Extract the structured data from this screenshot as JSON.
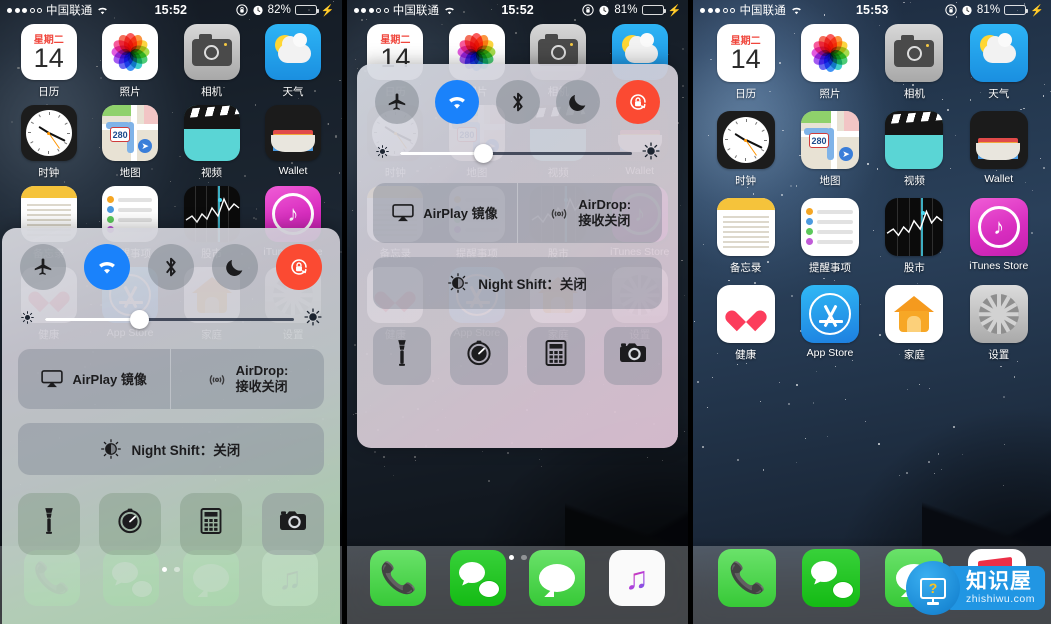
{
  "panes": [
    {
      "id": "pane-left",
      "status": {
        "carrier": "中国联通",
        "signal_filled": 3,
        "signal_total": 5,
        "wifi": "wifi-icon",
        "time": "15:52",
        "alarm": "alarm-icon",
        "lock": "rotation-lock-icon",
        "battery_text": "82%",
        "battery_level": 82,
        "charging": true
      },
      "control_center": {
        "visible": true,
        "toggles": [
          {
            "name": "airplane-mode",
            "icon": "airplane-icon",
            "state": "off"
          },
          {
            "name": "wifi",
            "icon": "wifi-icon",
            "state": "on"
          },
          {
            "name": "bluetooth",
            "icon": "bluetooth-icon",
            "state": "off"
          },
          {
            "name": "do-not-disturb",
            "icon": "moon-icon",
            "state": "off"
          },
          {
            "name": "rotation-lock",
            "icon": "rotation-lock-icon",
            "state": "on"
          }
        ],
        "brightness": {
          "value": 38,
          "min_icon": "sun-small-icon",
          "max_icon": "sun-large-icon"
        },
        "airplay_label": "AirPlay 镜像",
        "airdrop_label_line1": "AirDrop:",
        "airdrop_label_line2": "接收关闭",
        "night_shift_label": "Night Shift：关闭",
        "shortcuts": [
          {
            "name": "flashlight",
            "icon": "flashlight-icon"
          },
          {
            "name": "timer",
            "icon": "timer-icon"
          },
          {
            "name": "calculator",
            "icon": "calculator-icon"
          },
          {
            "name": "camera",
            "icon": "camera-icon"
          }
        ],
        "page_dots": {
          "count": 2,
          "active": 0
        }
      }
    },
    {
      "id": "pane-middle",
      "status": {
        "carrier": "中国联通",
        "signal_filled": 3,
        "signal_total": 5,
        "wifi": "wifi-icon",
        "time": "15:52",
        "alarm": "alarm-icon",
        "lock": "rotation-lock-icon",
        "battery_text": "81%",
        "battery_level": 81,
        "charging": true
      },
      "control_center": {
        "visible": true,
        "toggles": [
          {
            "name": "airplane-mode",
            "icon": "airplane-icon",
            "state": "off"
          },
          {
            "name": "wifi",
            "icon": "wifi-icon",
            "state": "on"
          },
          {
            "name": "bluetooth",
            "icon": "bluetooth-icon",
            "state": "off"
          },
          {
            "name": "do-not-disturb",
            "icon": "moon-icon",
            "state": "off"
          },
          {
            "name": "rotation-lock",
            "icon": "rotation-lock-icon",
            "state": "on"
          }
        ],
        "brightness": {
          "value": 36,
          "min_icon": "sun-small-icon",
          "max_icon": "sun-large-icon"
        },
        "airplay_label": "AirPlay 镜像",
        "airdrop_label_line1": "AirDrop:",
        "airdrop_label_line2": "接收关闭",
        "night_shift_label": "Night Shift：关闭",
        "shortcuts": [
          {
            "name": "flashlight",
            "icon": "flashlight-icon"
          },
          {
            "name": "timer",
            "icon": "timer-icon"
          },
          {
            "name": "calculator",
            "icon": "calculator-icon"
          },
          {
            "name": "camera",
            "icon": "camera-icon"
          }
        ],
        "page_dots": {
          "count": 2,
          "active": 0
        }
      },
      "dock": [
        {
          "name": "phone",
          "label": "电话"
        },
        {
          "name": "wechat",
          "label": "微信"
        },
        {
          "name": "messages",
          "label": "信息"
        },
        {
          "name": "music",
          "label": "音乐"
        }
      ]
    },
    {
      "id": "pane-right",
      "status": {
        "carrier": "中国联通",
        "signal_filled": 3,
        "signal_total": 5,
        "wifi": "wifi-icon",
        "time": "15:53",
        "alarm": "alarm-icon",
        "lock": "rotation-lock-icon",
        "battery_text": "81%",
        "battery_level": 81,
        "charging": true
      },
      "control_center": {
        "visible": false
      },
      "dock": [
        {
          "name": "phone",
          "label": "电话"
        },
        {
          "name": "wechat",
          "label": "微信"
        },
        {
          "name": "messages",
          "label": "信息"
        },
        {
          "name": "newsstand",
          "label": "报刊杂志"
        }
      ]
    }
  ],
  "home_apps": [
    {
      "name": "calendar",
      "label": "日历",
      "weekday": "星期二",
      "day": "14"
    },
    {
      "name": "photos",
      "label": "照片"
    },
    {
      "name": "camera",
      "label": "相机"
    },
    {
      "name": "weather",
      "label": "天气"
    },
    {
      "name": "clock",
      "label": "时钟"
    },
    {
      "name": "maps",
      "label": "地图",
      "route": "280"
    },
    {
      "name": "videos",
      "label": "视频"
    },
    {
      "name": "wallet",
      "label": "Wallet"
    },
    {
      "name": "notes",
      "label": "备忘录"
    },
    {
      "name": "reminders",
      "label": "提醒事项"
    },
    {
      "name": "stocks",
      "label": "股市"
    },
    {
      "name": "itunes",
      "label": "iTunes Store"
    },
    {
      "name": "health",
      "label": "健康"
    },
    {
      "name": "appstore",
      "label": "App Store"
    },
    {
      "name": "home",
      "label": "家庭"
    },
    {
      "name": "settings",
      "label": "设置"
    }
  ],
  "watermark": {
    "cn": "知识屋",
    "url": "zhishiwu.com",
    "icon": "monitor-question-icon"
  },
  "colors": {
    "wifi_on": "#1a82fb",
    "rotation_lock_on": "#fb4a32",
    "toggle_off": "#828892",
    "battery_green": "#4cd964",
    "calendar_red": "#f0463c",
    "watermark_blue": "#2196e3"
  }
}
